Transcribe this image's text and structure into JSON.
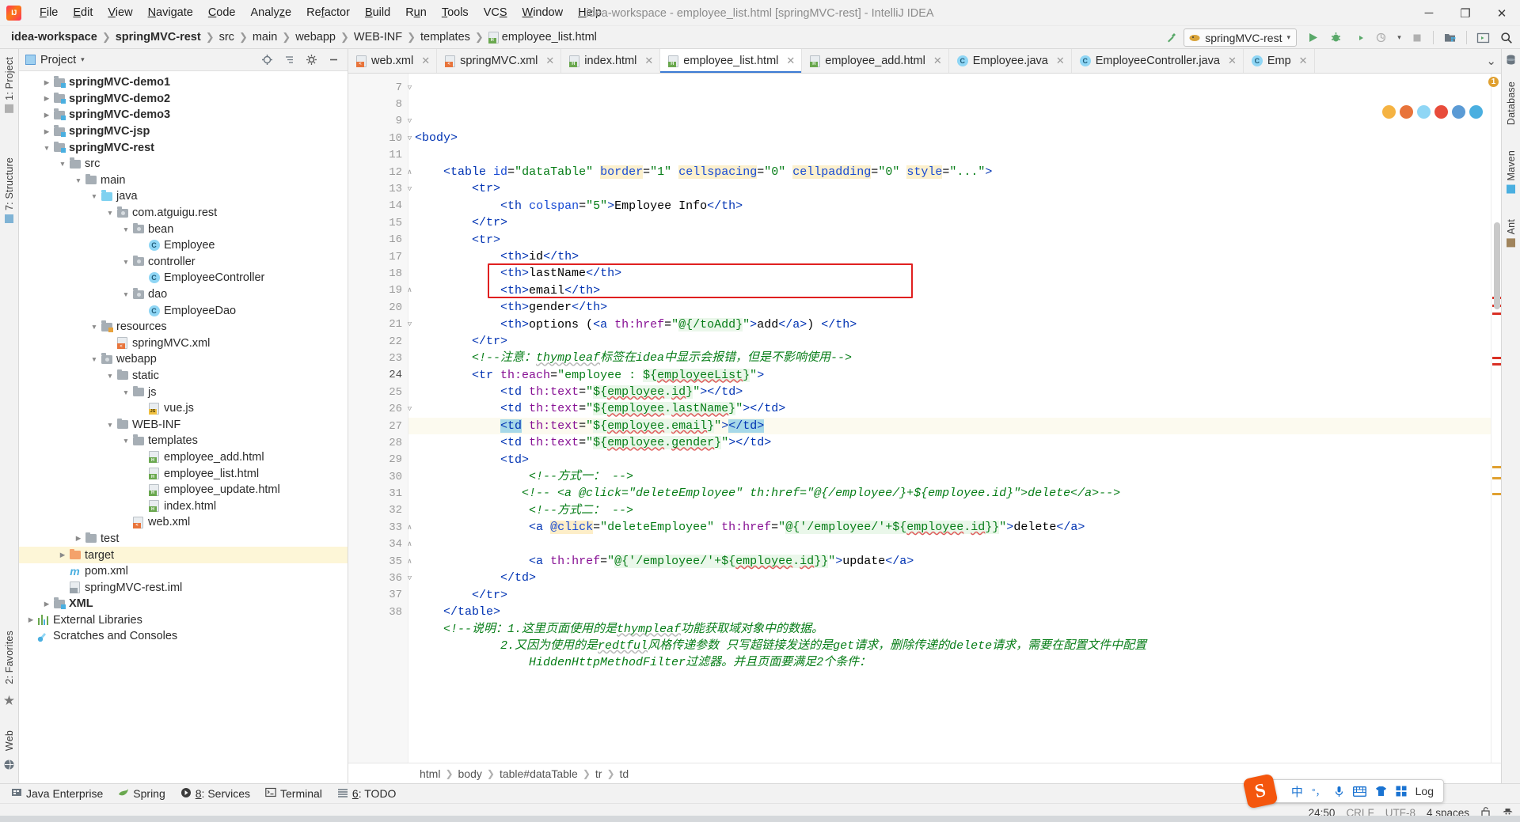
{
  "window": {
    "title": "idea-workspace - employee_list.html [springMVC-rest] - IntelliJ IDEA",
    "minimize": "─",
    "maximize": "❐",
    "close": "✕"
  },
  "menu": [
    {
      "label": "File"
    },
    {
      "label": "Edit"
    },
    {
      "label": "View"
    },
    {
      "label": "Navigate"
    },
    {
      "label": "Code"
    },
    {
      "label": "Analyze"
    },
    {
      "label": "Refactor"
    },
    {
      "label": "Build"
    },
    {
      "label": "Run"
    },
    {
      "label": "Tools"
    },
    {
      "label": "VCS"
    },
    {
      "label": "Window"
    },
    {
      "label": "Help"
    }
  ],
  "breadcrumb": {
    "items": [
      {
        "label": "idea-workspace",
        "bold": true
      },
      {
        "label": "springMVC-rest",
        "bold": true
      },
      {
        "label": "src",
        "bold": false
      },
      {
        "label": "main",
        "bold": false
      },
      {
        "label": "webapp",
        "bold": false
      },
      {
        "label": "WEB-INF",
        "bold": false
      },
      {
        "label": "templates",
        "bold": false
      },
      {
        "label": "employee_list.html",
        "bold": false
      }
    ],
    "separator": "❯"
  },
  "navbar_right": {
    "hammer_icon": "build-hammer-icon",
    "run_config": "springMVC-rest",
    "run_icon": "run-icon",
    "debug_icon": "debug-icon",
    "coverage_icon": "run-with-coverage-icon",
    "profile_icon": "profiler-icon",
    "stop_icon": "stop-icon",
    "project_structure_icon": "project-structure-icon",
    "console_icon": "console-icon",
    "search_icon": "search-everywhere-icon"
  },
  "left_strip": [
    {
      "label": "1: Project"
    },
    {
      "label": "7: Structure"
    },
    {
      "label": "2: Favorites"
    },
    {
      "label": "Web"
    }
  ],
  "right_strip": [
    {
      "label": "Database"
    },
    {
      "label": "Maven"
    },
    {
      "label": "Ant"
    }
  ],
  "project_panel": {
    "title": "Project",
    "dropdown": "▾",
    "locate_icon": "locate-icon",
    "collapse_icon": "collapse-all-icon",
    "settings_icon": "gear-icon",
    "hide_icon": "hide-icon",
    "tree": [
      {
        "label": "springMVC-demo1",
        "depth": 1,
        "arrow": "collapsed",
        "icon": "module-folder",
        "bold": true
      },
      {
        "label": "springMVC-demo2",
        "depth": 1,
        "arrow": "collapsed",
        "icon": "module-folder",
        "bold": true
      },
      {
        "label": "springMVC-demo3",
        "depth": 1,
        "arrow": "collapsed",
        "icon": "module-folder",
        "bold": true
      },
      {
        "label": "springMVC-jsp",
        "depth": 1,
        "arrow": "collapsed",
        "icon": "module-folder",
        "bold": true
      },
      {
        "label": "springMVC-rest",
        "depth": 1,
        "arrow": "expanded",
        "icon": "module-folder",
        "bold": true
      },
      {
        "label": "src",
        "depth": 2,
        "arrow": "expanded",
        "icon": "folder",
        "bold": false
      },
      {
        "label": "main",
        "depth": 3,
        "arrow": "expanded",
        "icon": "folder",
        "bold": false
      },
      {
        "label": "java",
        "depth": 4,
        "arrow": "expanded",
        "icon": "source-folder",
        "bold": false
      },
      {
        "label": "com.atguigu.rest",
        "depth": 5,
        "arrow": "expanded",
        "icon": "package",
        "bold": false
      },
      {
        "label": "bean",
        "depth": 6,
        "arrow": "expanded",
        "icon": "package",
        "bold": false
      },
      {
        "label": "Employee",
        "depth": 7,
        "arrow": "none",
        "icon": "class",
        "bold": false
      },
      {
        "label": "controller",
        "depth": 6,
        "arrow": "expanded",
        "icon": "package",
        "bold": false
      },
      {
        "label": "EmployeeController",
        "depth": 7,
        "arrow": "none",
        "icon": "class",
        "bold": false
      },
      {
        "label": "dao",
        "depth": 6,
        "arrow": "expanded",
        "icon": "package",
        "bold": false
      },
      {
        "label": "EmployeeDao",
        "depth": 7,
        "arrow": "none",
        "icon": "class",
        "bold": false
      },
      {
        "label": "resources",
        "depth": 4,
        "arrow": "expanded",
        "icon": "resource-folder",
        "bold": false
      },
      {
        "label": "springMVC.xml",
        "depth": 5,
        "arrow": "none",
        "icon": "spring-xml-file",
        "bold": false
      },
      {
        "label": "webapp",
        "depth": 4,
        "arrow": "expanded",
        "icon": "webapp-folder",
        "bold": false
      },
      {
        "label": "static",
        "depth": 5,
        "arrow": "expanded",
        "icon": "folder",
        "bold": false
      },
      {
        "label": "js",
        "depth": 6,
        "arrow": "expanded",
        "icon": "folder",
        "bold": false
      },
      {
        "label": "vue.js",
        "depth": 7,
        "arrow": "none",
        "icon": "js-file",
        "bold": false
      },
      {
        "label": "WEB-INF",
        "depth": 5,
        "arrow": "expanded",
        "icon": "folder",
        "bold": false
      },
      {
        "label": "templates",
        "depth": 6,
        "arrow": "expanded",
        "icon": "folder",
        "bold": false
      },
      {
        "label": "employee_add.html",
        "depth": 7,
        "arrow": "none",
        "icon": "html-file",
        "bold": false
      },
      {
        "label": "employee_list.html",
        "depth": 7,
        "arrow": "none",
        "icon": "html-file",
        "bold": false
      },
      {
        "label": "employee_update.html",
        "depth": 7,
        "arrow": "none",
        "icon": "html-file",
        "bold": false
      },
      {
        "label": "index.html",
        "depth": 7,
        "arrow": "none",
        "icon": "html-file",
        "bold": false
      },
      {
        "label": "web.xml",
        "depth": 6,
        "arrow": "none",
        "icon": "xml-file",
        "bold": false
      },
      {
        "label": "test",
        "depth": 3,
        "arrow": "collapsed",
        "icon": "folder",
        "bold": false
      },
      {
        "label": "target",
        "depth": 2,
        "arrow": "collapsed",
        "icon": "target-folder",
        "bold": false,
        "selected": true
      },
      {
        "label": "pom.xml",
        "depth": 2,
        "arrow": "none",
        "icon": "maven-file",
        "bold": false
      },
      {
        "label": "springMVC-rest.iml",
        "depth": 2,
        "arrow": "none",
        "icon": "iml-file",
        "bold": false
      },
      {
        "label": "XML",
        "depth": 1,
        "arrow": "collapsed",
        "icon": "module-folder",
        "bold": true
      },
      {
        "label": "External Libraries",
        "depth": 0,
        "arrow": "collapsed",
        "icon": "library",
        "bold": false
      },
      {
        "label": "Scratches and Consoles",
        "depth": 0,
        "arrow": "none",
        "icon": "scratches",
        "bold": false
      }
    ]
  },
  "editor_tabs": [
    {
      "label": "web.xml",
      "icon": "xml-file",
      "active": false
    },
    {
      "label": "springMVC.xml",
      "icon": "spring-xml-file",
      "active": false
    },
    {
      "label": "index.html",
      "icon": "html-file",
      "active": false
    },
    {
      "label": "employee_list.html",
      "icon": "html-file",
      "active": true
    },
    {
      "label": "employee_add.html",
      "icon": "html-file",
      "active": false
    },
    {
      "label": "Employee.java",
      "icon": "class",
      "active": false
    },
    {
      "label": "EmployeeController.java",
      "icon": "class",
      "active": false
    },
    {
      "label": "Emp",
      "icon": "class",
      "active": false
    }
  ],
  "editor_tabs_overflow": "⌄",
  "code": {
    "lines": [
      {
        "n": 7,
        "fold": "minus"
      },
      {
        "n": 8,
        "fold": ""
      },
      {
        "n": 9,
        "fold": "minus"
      },
      {
        "n": 10,
        "fold": "minus"
      },
      {
        "n": 11,
        "fold": ""
      },
      {
        "n": 12,
        "fold": "end"
      },
      {
        "n": 13,
        "fold": "minus"
      },
      {
        "n": 14,
        "fold": ""
      },
      {
        "n": 15,
        "fold": ""
      },
      {
        "n": 16,
        "fold": ""
      },
      {
        "n": 17,
        "fold": ""
      },
      {
        "n": 18,
        "fold": ""
      },
      {
        "n": 19,
        "fold": "end"
      },
      {
        "n": 20,
        "fold": ""
      },
      {
        "n": 21,
        "fold": "minus"
      },
      {
        "n": 22,
        "fold": ""
      },
      {
        "n": 23,
        "fold": ""
      },
      {
        "n": 24,
        "fold": "",
        "current": true
      },
      {
        "n": 25,
        "fold": ""
      },
      {
        "n": 26,
        "fold": "minus"
      },
      {
        "n": 27,
        "fold": ""
      },
      {
        "n": 28,
        "fold": ""
      },
      {
        "n": 29,
        "fold": ""
      },
      {
        "n": 30,
        "fold": ""
      },
      {
        "n": 31,
        "fold": ""
      },
      {
        "n": 32,
        "fold": ""
      },
      {
        "n": 33,
        "fold": "end"
      },
      {
        "n": 34,
        "fold": "end"
      },
      {
        "n": 35,
        "fold": "end"
      },
      {
        "n": 36,
        "fold": "minus"
      },
      {
        "n": 37,
        "fold": ""
      },
      {
        "n": 38,
        "fold": ""
      }
    ],
    "text": [
      "<body>",
      "",
      "    <table id=\"dataTable\" border=\"1\" cellspacing=\"0\" cellpadding=\"0\" style=\"...\">",
      "        <tr>",
      "            <th colspan=\"5\">Employee Info</th>",
      "        </tr>",
      "        <tr>",
      "            <th>id</th>",
      "            <th>lastName</th>",
      "            <th>email</th>",
      "            <th>gender</th>",
      "            <th>options (<a th:href=\"@{/toAdd}\">add</a>) </th>",
      "        </tr>",
      "        <!--注意：thympleaf标签在idea中显示会报错，但是不影响使用-->",
      "        <tr th:each=\"employee : ${employeeList}\">",
      "            <td th:text=\"${employee.id}\"></td>",
      "            <td th:text=\"${employee.lastName}\"></td>",
      "            <td th:text=\"${employee.email}\"></td>",
      "            <td th:text=\"${employee.gender}\"></td>",
      "            <td>",
      "                <!--方式一： -->",
      "               <!-- <a @click=\"deleteEmployee\" th:href=\"@{/employee/}+${employee.id}\">delete</a>-->",
      "                <!--方式二： -->",
      "                <a @click=\"deleteEmployee\" th:href=\"@{'/employee/'+${employee.id}}\">delete</a>",
      "",
      "                <a th:href=\"@{'/employee/'+${employee.id}}\">update</a>",
      "            </td>",
      "        </tr>",
      "    </table>",
      "    <!--说明：1.这里页面使用的是thympleaf功能获取域对象中的数据。",
      "            2.又因为使用的是redtful风格传递参数 只写超链接发送的是get请求，删除传递的delete请求，需要在配置文件中配置",
      "                HiddenHttpMethodFilter过滤器。并且页面要满足2个条件："
    ],
    "highlight_box_line": 18,
    "inspection_count": "1",
    "inspection_dots": [
      "#f5b342",
      "#e8743b",
      "#8fd6f5",
      "#e84c3b",
      "#5b9bd5",
      "#4aafe0"
    ]
  },
  "editor_breadcrumbs": {
    "items": [
      "html",
      "body",
      "table#dataTable",
      "tr",
      "td"
    ],
    "separator": "❯"
  },
  "bottom_bar": [
    {
      "label": "Java Enterprise",
      "icon": "java-enterprise-icon",
      "mnemonic": ""
    },
    {
      "label": "Spring",
      "icon": "spring-leaf-icon",
      "mnemonic": ""
    },
    {
      "label": "Services",
      "icon": "services-icon",
      "mnemonic": "8"
    },
    {
      "label": "Terminal",
      "icon": "terminal-icon",
      "mnemonic": ""
    },
    {
      "label": "TODO",
      "icon": "todo-icon",
      "mnemonic": "6"
    }
  ],
  "status_bar": {
    "caret": "24:50",
    "line_sep": "CRLF",
    "encoding": "UTF-8",
    "indent": "4 spaces",
    "lock_icon": "unlocked-icon",
    "inspection_icon": "inspector-hat-icon",
    "log_label": "Log",
    "event_icon": "event-log-icon"
  },
  "ime": {
    "logo": "S",
    "buttons": [
      {
        "icon": "chinese-input-mode",
        "glyph": "中"
      },
      {
        "icon": "punctuation-mode",
        "glyph": "°，"
      },
      {
        "icon": "voice-input",
        "glyph": "⬛"
      },
      {
        "icon": "soft-keyboard",
        "glyph": "⌨"
      },
      {
        "icon": "skin-theme",
        "glyph": "⬟"
      },
      {
        "icon": "toolbox",
        "glyph": "▒"
      }
    ]
  }
}
